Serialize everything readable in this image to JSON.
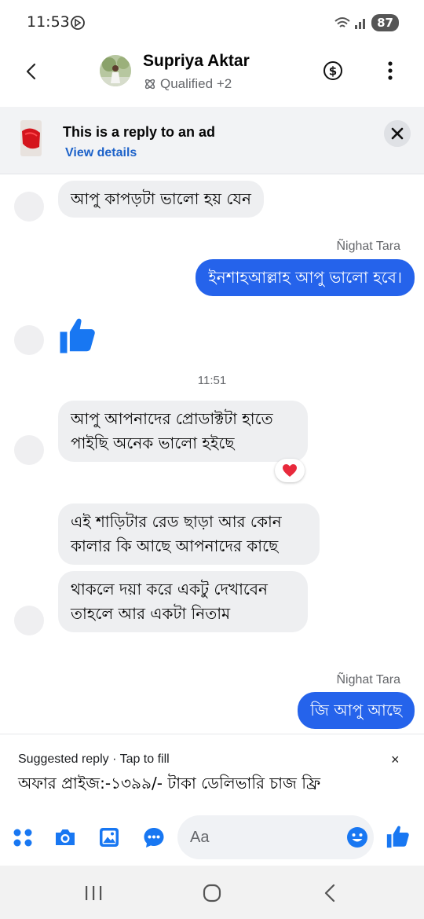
{
  "status_bar": {
    "time": "11:53",
    "battery": "87"
  },
  "header": {
    "contact_name": "Supriya Aktar",
    "subtitle": "Qualified +2"
  },
  "ad_banner": {
    "title": "This is a reply to an ad",
    "link": "View details"
  },
  "messages": [
    {
      "direction": "in",
      "text": "আপু কাপড়টা ভালো হয় যেন"
    },
    {
      "direction": "out",
      "sender": "Ñighat Tara",
      "text": "ইনশাহআল্লাহ আপু ভালো হবে।"
    },
    {
      "direction": "in",
      "type": "like"
    },
    {
      "direction": "in",
      "text": "আপু আপনাদের প্রোডাক্টটা হাতে পাইছি অনেক ভালো হইছে",
      "reaction": "heart"
    },
    {
      "direction": "in",
      "text": "এই শাড়িটার রেড ছাড়া আর কোন কালার কি আছে আপনাদের কাছে"
    },
    {
      "direction": "in",
      "text": "থাকলে দয়া করে একটু দেখাবেন তাহলে আর একটা নিতাম"
    },
    {
      "direction": "out",
      "sender": "Ñighat Tara",
      "text": "জি আপু আছে"
    }
  ],
  "timestamp": "11:51",
  "suggested_reply": {
    "label": "Suggested reply · Tap to fill",
    "text": "অফার প্রাইজ:-১৩৯৯/- টাকা ডেলিভারি চাজ ফ্রি",
    "close": "×"
  },
  "composer": {
    "placeholder": "Aa"
  },
  "colors": {
    "accent": "#2563eb",
    "incoming_bubble": "#eeeff1",
    "link": "#1d62c9"
  },
  "icons": [
    "dnd-icon",
    "wifi-icon",
    "signal-icon",
    "back-icon",
    "dollar-icon",
    "more-icon",
    "close-icon",
    "menu-icon",
    "camera-icon",
    "image-icon",
    "sticker-icon",
    "emoji-icon",
    "like-icon",
    "heart-icon"
  ]
}
